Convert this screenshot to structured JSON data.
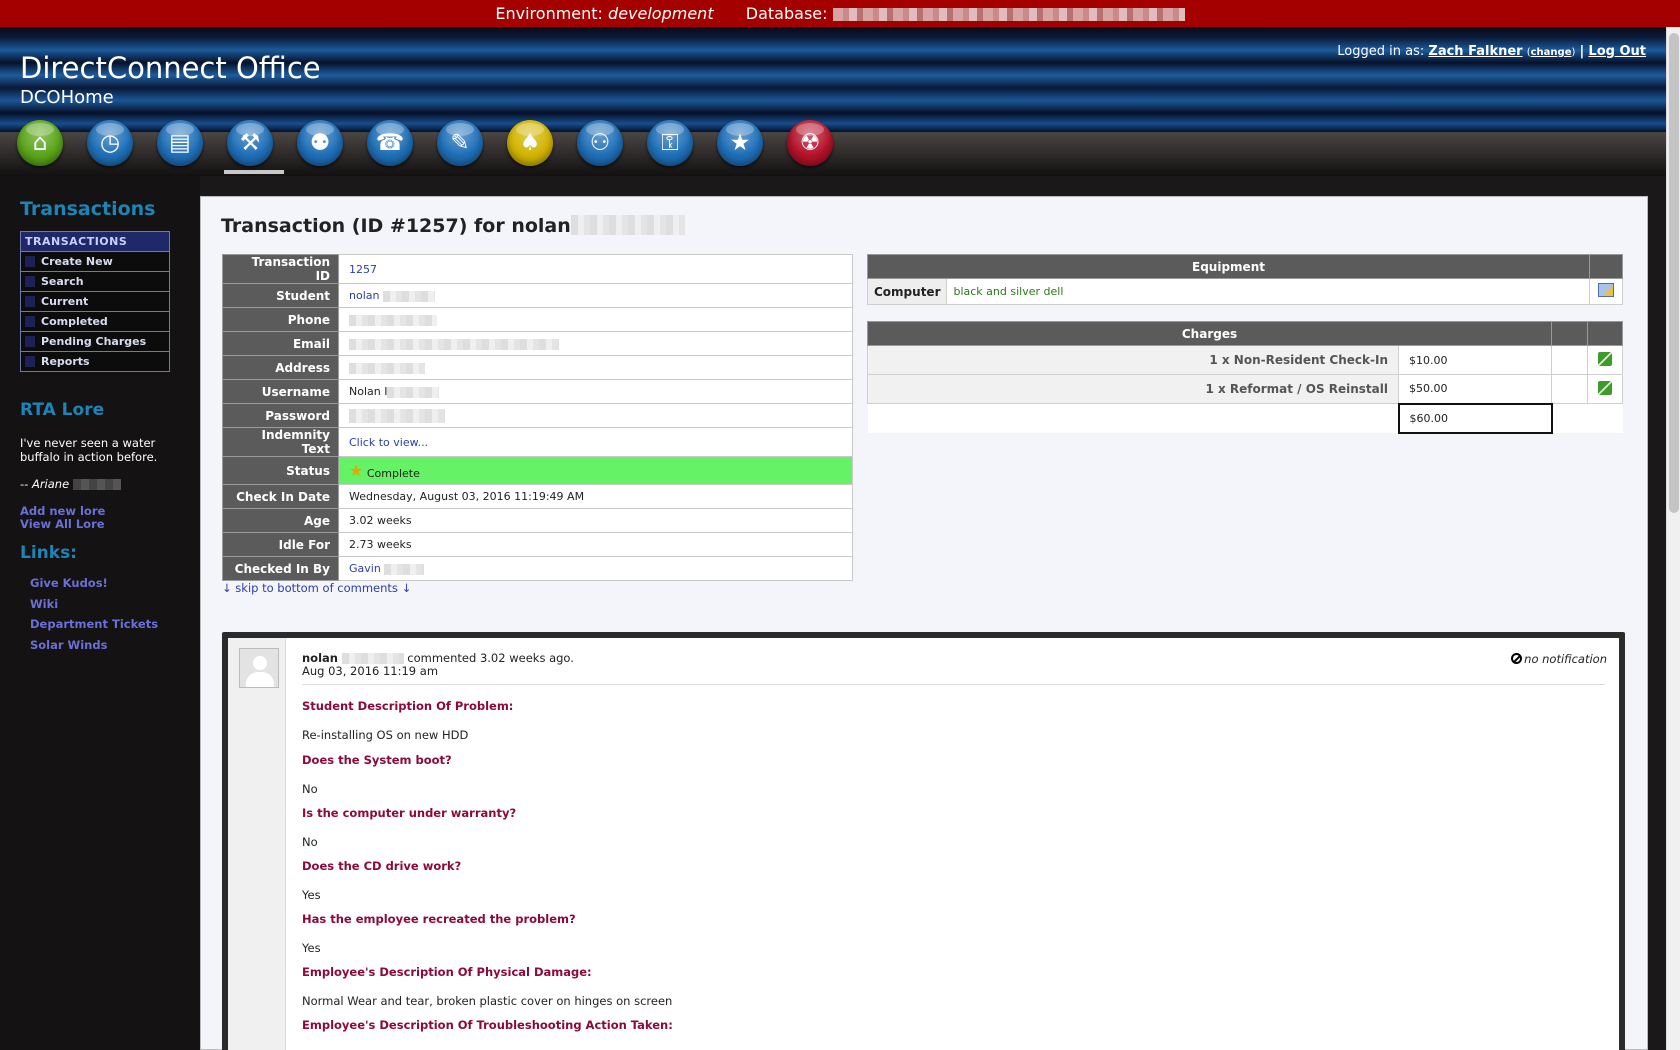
{
  "env_bar": {
    "env_label": "Environment:",
    "env_value": "development",
    "db_label": "Database:"
  },
  "header": {
    "app_title": "DirectConnect Office",
    "subtitle": "DCOHome",
    "logged_in_label": "Logged in as:",
    "user_name": "Zach Falkner",
    "change_label": "change",
    "logout_label": "Log Out"
  },
  "nav": {
    "icons": [
      {
        "name": "home-icon",
        "glyph": "⌂",
        "color": "#5aa51a"
      },
      {
        "name": "clock-icon",
        "glyph": "◷",
        "color": "#1f6fb8"
      },
      {
        "name": "ticket-icon",
        "glyph": "▤",
        "color": "#1f6fb8"
      },
      {
        "name": "tools-icon",
        "glyph": "⚒",
        "color": "#1f6fb8"
      },
      {
        "name": "people-icon",
        "glyph": "⚉",
        "color": "#1f6fb8"
      },
      {
        "name": "phone-icon",
        "glyph": "☎",
        "color": "#1f6fb8"
      },
      {
        "name": "pen-icon",
        "glyph": "✎",
        "color": "#1f6fb8"
      },
      {
        "name": "spade-icon",
        "glyph": "♠",
        "color": "#d2b400"
      },
      {
        "name": "group-icon",
        "glyph": "⚇",
        "color": "#1f6fb8"
      },
      {
        "name": "key-icon",
        "glyph": "⚿",
        "color": "#1f6fb8"
      },
      {
        "name": "star-icon",
        "glyph": "★",
        "color": "#1f6fb8"
      },
      {
        "name": "radiation-icon",
        "glyph": "☢",
        "color": "#b5122a"
      }
    ],
    "active_index": 3
  },
  "sidebar": {
    "transactions_heading": "Transactions",
    "menu_header": "TRANSACTIONS",
    "menu_items": [
      "Create New",
      "Search",
      "Current",
      "Completed",
      "Pending Charges",
      "Reports"
    ],
    "lore_heading": "RTA Lore",
    "lore_quote": "I've never seen a water buffalo in action before.",
    "lore_author": "-- Ariane",
    "add_lore": "Add new lore",
    "view_lore": "View All Lore",
    "links_heading": "Links:",
    "links": [
      "Give Kudos!",
      "Wiki",
      "Department Tickets",
      "Solar Winds"
    ]
  },
  "page": {
    "title": "Transaction (ID #1257) for nolan"
  },
  "transaction": {
    "labels": [
      "Transaction ID",
      "Student",
      "Phone",
      "Email",
      "Address",
      "Username",
      "Password",
      "Indemnity Text",
      "Status",
      "Check In Date",
      "Age",
      "Idle For",
      "Checked In By"
    ],
    "transaction_id": "1257",
    "student": "nolan",
    "username": "Nolan I",
    "indemnity_link": "Click to view...",
    "status": "Complete",
    "check_in_date": "Wednesday, August 03, 2016 11:19:49 AM",
    "age": "3.02 weeks",
    "idle_for": "2.73 weeks",
    "checked_in_by": "Gavin"
  },
  "equipment": {
    "heading": "Equipment",
    "type": "Computer",
    "description": "black and silver dell"
  },
  "charges": {
    "heading": "Charges",
    "items": [
      {
        "desc": "1 x Non-Resident Check-In",
        "amount": "$10.00"
      },
      {
        "desc": "1 x Reformat / OS Reinstall",
        "amount": "$50.00"
      }
    ],
    "total": "$60.00"
  },
  "comments": {
    "skip_link": "↓ skip to bottom of comments ↓",
    "author": "nolan",
    "meta": "commented 3.02 weeks ago.",
    "date": "Aug 03, 2016 11:19 am",
    "notification": "no notification",
    "qa": [
      {
        "q": "Student Description Of Problem:",
        "a": "Re-installing OS on new HDD"
      },
      {
        "q": "Does the System boot?",
        "a": "No"
      },
      {
        "q": "Is the computer under warranty?",
        "a": "No"
      },
      {
        "q": "Does the CD drive work?",
        "a": "Yes"
      },
      {
        "q": "Has the employee recreated the problem?",
        "a": "Yes"
      },
      {
        "q": "Employee's Description Of Physical Damage:",
        "a": "Normal Wear and tear, broken plastic cover on hinges on screen"
      },
      {
        "q": "Employee's Description Of Troubleshooting Action Taken:",
        "a": ""
      }
    ]
  }
}
